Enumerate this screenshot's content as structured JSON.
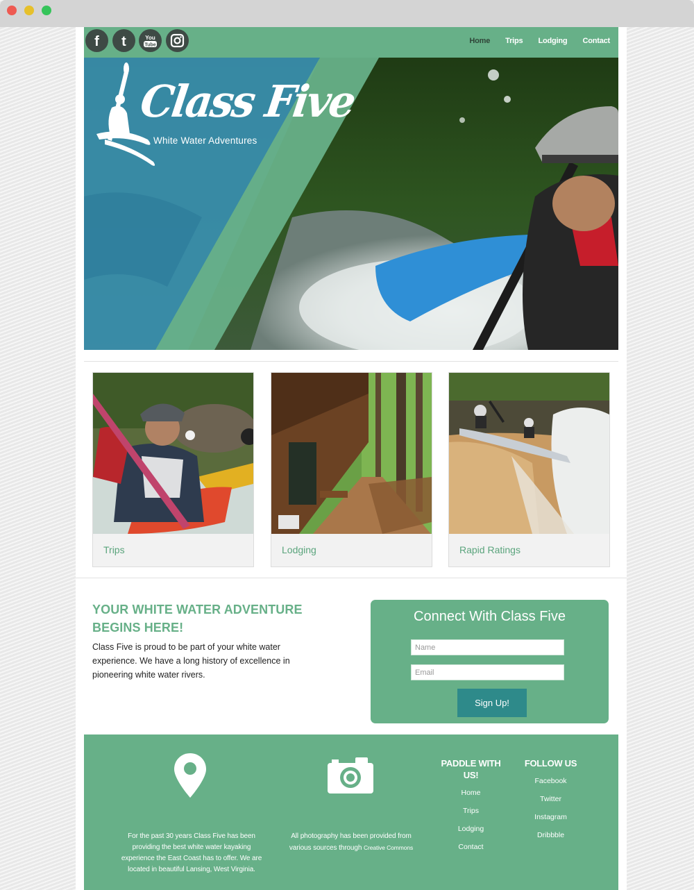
{
  "colors": {
    "brand_green": "#67b088",
    "dark_teal_button": "#2e8a8a",
    "card_label_green": "#5aa47c",
    "active_nav": "#2f4538"
  },
  "social": [
    {
      "icon": "facebook-icon",
      "glyph": "f"
    },
    {
      "icon": "twitter-icon",
      "glyph": "t"
    },
    {
      "icon": "youtube-icon",
      "glyph": "You Tube"
    },
    {
      "icon": "instagram-icon",
      "glyph": ""
    }
  ],
  "nav": {
    "items": [
      {
        "label": "Home",
        "active": true
      },
      {
        "label": "Trips",
        "active": false
      },
      {
        "label": "Lodging",
        "active": false
      },
      {
        "label": "Contact",
        "active": false
      }
    ]
  },
  "hero": {
    "logo_title": "Class Five",
    "logo_tagline": "White Water Adventures"
  },
  "cards": [
    {
      "label": "Trips"
    },
    {
      "label": "Lodging"
    },
    {
      "label": "Rapid Ratings"
    }
  ],
  "intro": {
    "title": "YOUR WHITE WATER ADVENTURE BEGINS HERE!",
    "text": "Class Five is proud to be part of your white water experience. We have a long history of excellence in pioneering white water rivers."
  },
  "signup": {
    "title": "Connect With Class Five",
    "name_placeholder": "Name",
    "email_placeholder": "Email",
    "button_label": "Sign Up!"
  },
  "footer": {
    "about_text": "For the past 30 years Class Five has been providing the best white water kayaking experience the East Coast has to offer. We are located in beautiful Lansing, West Virginia.",
    "photo_text_main": "All photography has been provided from various sources through",
    "photo_text_link": "Creative Commons",
    "paddle_title": "PADDLE WITH US!",
    "paddle_links": [
      "Home",
      "Trips",
      "Lodging",
      "Contact"
    ],
    "follow_title": "FOLLOW US",
    "follow_links": [
      "Facebook",
      "Twitter",
      "Instagram",
      "Dribbble"
    ]
  }
}
